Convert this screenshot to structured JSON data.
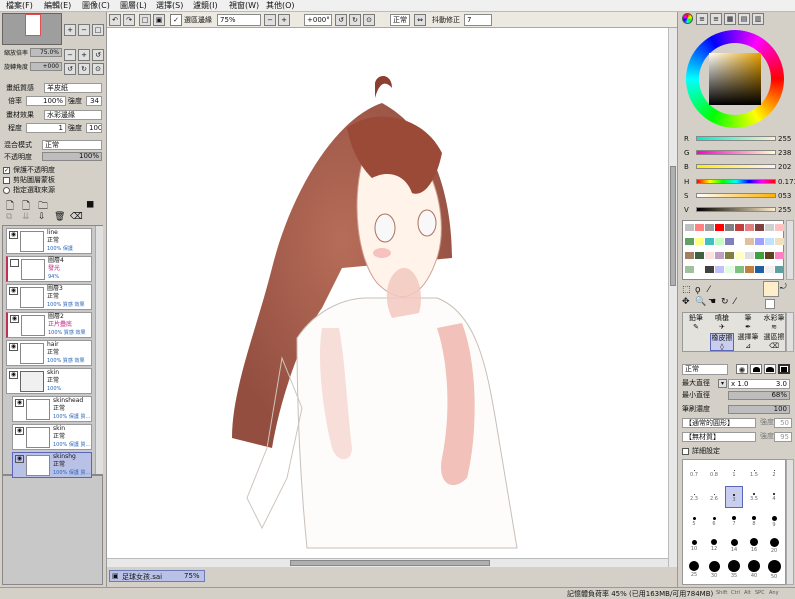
{
  "menu": {
    "items": [
      "檔案(F)",
      "編輯(E)",
      "圖像(C)",
      "圖層(L)",
      "選擇(S)",
      "濾鏡(I)",
      "視窗(W)",
      "其他(O)"
    ]
  },
  "toolbar": {
    "select_source_label": "選區邊緣",
    "zoom": "75%",
    "angle": "+000°",
    "mode": "正常",
    "stabilizer_label": "抖動修正",
    "stabilizer": "7"
  },
  "navigator": {
    "zoom_label": "縮放倍率",
    "zoom_value": "75.0%",
    "angle_label": "旋轉角度",
    "angle_value": "+000"
  },
  "paper": {
    "texture_label": "畫紙質感",
    "texture_value": "羊皮紙",
    "scale_label": "倍率",
    "scale_value": "100%",
    "strength_label": "強度",
    "strength_value": "34",
    "effect_label": "畫材效果",
    "effect_value": "水彩邊緣",
    "level_label": "程度",
    "level_value": "1",
    "effect_strength_label": "強度",
    "effect_strength_value": "100"
  },
  "blend": {
    "label": "混合模式",
    "value": "正常",
    "opacity_label": "不透明度",
    "opacity_value": "100%"
  },
  "options": {
    "preserve": "保護不透明度",
    "clip": "剪貼圖層蒙板",
    "selection": "指定選取來源"
  },
  "layers": [
    {
      "name": "line",
      "mode": "正常",
      "opacity": "100% 保護",
      "has_eye": true,
      "indent": false,
      "folder": false,
      "selected": false,
      "red": false
    },
    {
      "name": "圖層4",
      "mode": "發光",
      "opacity": "94%",
      "has_eye": false,
      "indent": false,
      "folder": false,
      "selected": false,
      "red": true
    },
    {
      "name": "圖層3",
      "mode": "正常",
      "opacity": "100% 質感 效果",
      "has_eye": true,
      "indent": false,
      "folder": false,
      "selected": false,
      "red": false
    },
    {
      "name": "圖層2",
      "mode": "正片疊底",
      "opacity": "100% 質感 效果",
      "has_eye": true,
      "indent": false,
      "folder": false,
      "selected": false,
      "red": true
    },
    {
      "name": "hair",
      "mode": "正常",
      "opacity": "100% 質感 效果",
      "has_eye": true,
      "indent": false,
      "folder": false,
      "selected": false,
      "red": false
    },
    {
      "name": "skin",
      "mode": "正常",
      "opacity": "100%",
      "has_eye": true,
      "indent": false,
      "folder": true,
      "selected": false,
      "red": false
    },
    {
      "name": "skinshead",
      "mode": "正常",
      "opacity": "100% 保護 質...",
      "has_eye": true,
      "indent": true,
      "folder": false,
      "selected": false,
      "red": false
    },
    {
      "name": "skin",
      "mode": "正常",
      "opacity": "100% 保護 質...",
      "has_eye": true,
      "indent": true,
      "folder": false,
      "selected": false,
      "red": false
    },
    {
      "name": "skinshg",
      "mode": "正常",
      "opacity": "100% 保護 質...",
      "has_eye": true,
      "indent": true,
      "folder": false,
      "selected": true,
      "red": false
    }
  ],
  "tab": {
    "name": "足球女孩.sai",
    "zoom": "75%"
  },
  "status": {
    "memory": "記憶體負荷率 45% (已用163MB/可用784MB)",
    "keys": [
      "Shift",
      "Ctrl",
      "Alt",
      "SPC",
      "Any"
    ]
  },
  "color": {
    "r_label": "R",
    "r": "255",
    "g_label": "G",
    "g": "238",
    "b_label": "B",
    "b": "202",
    "h_label": "H",
    "h": "0.173",
    "s_label": "S",
    "s": "053",
    "v_label": "V",
    "v": "255",
    "current": "#ffeeca"
  },
  "swatches": [
    "#c0c0c0",
    "#ff8080",
    "#a0a0a0",
    "#ff0000",
    "#808080",
    "#c04040",
    "#e08080",
    "#804040",
    "#d0d0d0",
    "#ffc0c0",
    "#60a060",
    "#ffff80",
    "#40c0c0",
    "#c0ffc0",
    "#8080c0",
    "#ffffff",
    "#e0c0a0",
    "#a0a0ff",
    "#c0e0ff",
    "#f0e0c0",
    "#a08060",
    "#406040",
    "#ffe0e0",
    "#c0a0c0",
    "#808040",
    "#ffffc0",
    "#e0e0e0",
    "#40a040",
    "#604020",
    "#ff80c0",
    "#a0c0a0",
    "#ffffff",
    "#404040",
    "#c0c0ff",
    "#e0ffe0",
    "#80c080",
    "#c08040",
    "#2060a0",
    "#f0f0f0",
    "#60a0a0"
  ],
  "tools": [
    "鉛筆",
    "噴槍",
    "筆",
    "水彩筆",
    "",
    "橡皮擦",
    "選擇筆",
    "選區擦"
  ],
  "brush": {
    "mode": "正常",
    "max_label": "最大直徑",
    "max_value": "x 1.0",
    "max_size": "3.0",
    "min_label": "最小直徑",
    "min_value": "68%",
    "density_label": "筆刷濃度",
    "density_value": "100",
    "shape": "【通常的圓形】",
    "shape_strength_label": "強度",
    "shape_strength": "50",
    "texture": "【無材質】",
    "texture_strength_label": "強度",
    "texture_strength": "95",
    "detail_label": "詳細設定"
  },
  "brush_sizes": [
    "0.7",
    "0.8",
    "1",
    "1.5",
    "2",
    "2.3",
    "2.6",
    "3",
    "3.5",
    "4",
    "5",
    "6",
    "7",
    "8",
    "9",
    "10",
    "12",
    "14",
    "16",
    "20",
    "25",
    "30",
    "35",
    "40",
    "50"
  ]
}
